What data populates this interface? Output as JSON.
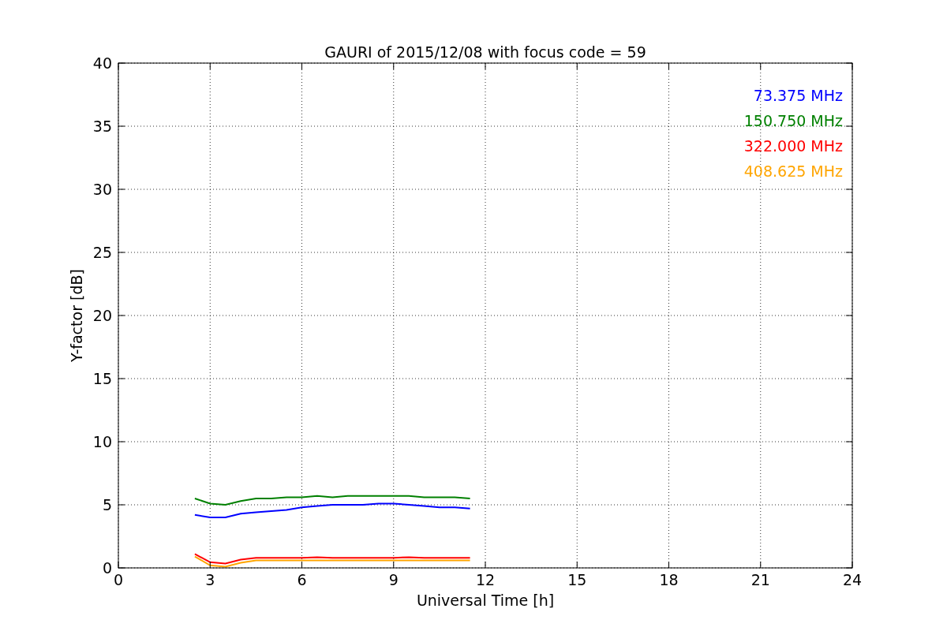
{
  "figure": {
    "chart_data": {
      "type": "line",
      "title": "GAURI of 2015/12/08 with focus code = 59",
      "xlabel": "Universal Time [h]",
      "ylabel": "Y-factor [dB]",
      "x": [
        2.5,
        3,
        3.5,
        4,
        4.5,
        5,
        5.5,
        6,
        6.5,
        7,
        7.5,
        8,
        8.5,
        9,
        9.5,
        10,
        10.5,
        11,
        11.5
      ],
      "series": [
        {
          "name": "73.375 MHz",
          "color": "#0000ff",
          "values": [
            4.2,
            4.0,
            4.0,
            4.3,
            4.4,
            4.5,
            4.6,
            4.8,
            4.9,
            5.0,
            5.0,
            5.0,
            5.1,
            5.1,
            5.0,
            4.9,
            4.8,
            4.8,
            4.7
          ]
        },
        {
          "name": "150.750 MHz",
          "color": "#008000",
          "values": [
            5.5,
            5.1,
            5.0,
            5.3,
            5.5,
            5.5,
            5.6,
            5.6,
            5.7,
            5.6,
            5.7,
            5.7,
            5.7,
            5.7,
            5.7,
            5.6,
            5.6,
            5.6,
            5.5
          ]
        },
        {
          "name": "322.000 MHz",
          "color": "#ff0000",
          "values": [
            1.1,
            0.45,
            0.35,
            0.65,
            0.8,
            0.8,
            0.8,
            0.8,
            0.85,
            0.8,
            0.8,
            0.8,
            0.8,
            0.8,
            0.85,
            0.8,
            0.8,
            0.8,
            0.8
          ]
        },
        {
          "name": "408.625 MHz",
          "color": "#ffa500",
          "values": [
            0.9,
            0.2,
            0.1,
            0.4,
            0.6,
            0.6,
            0.6,
            0.6,
            0.6,
            0.6,
            0.6,
            0.6,
            0.6,
            0.6,
            0.6,
            0.6,
            0.6,
            0.6,
            0.6
          ]
        }
      ],
      "grid": true,
      "xlim": [
        0,
        24
      ],
      "ylim": [
        0,
        40
      ],
      "xticks": [
        0,
        3,
        6,
        9,
        12,
        15,
        18,
        21,
        24
      ],
      "yticks": [
        0,
        5,
        10,
        15,
        20,
        25,
        30,
        35,
        40
      ]
    }
  }
}
